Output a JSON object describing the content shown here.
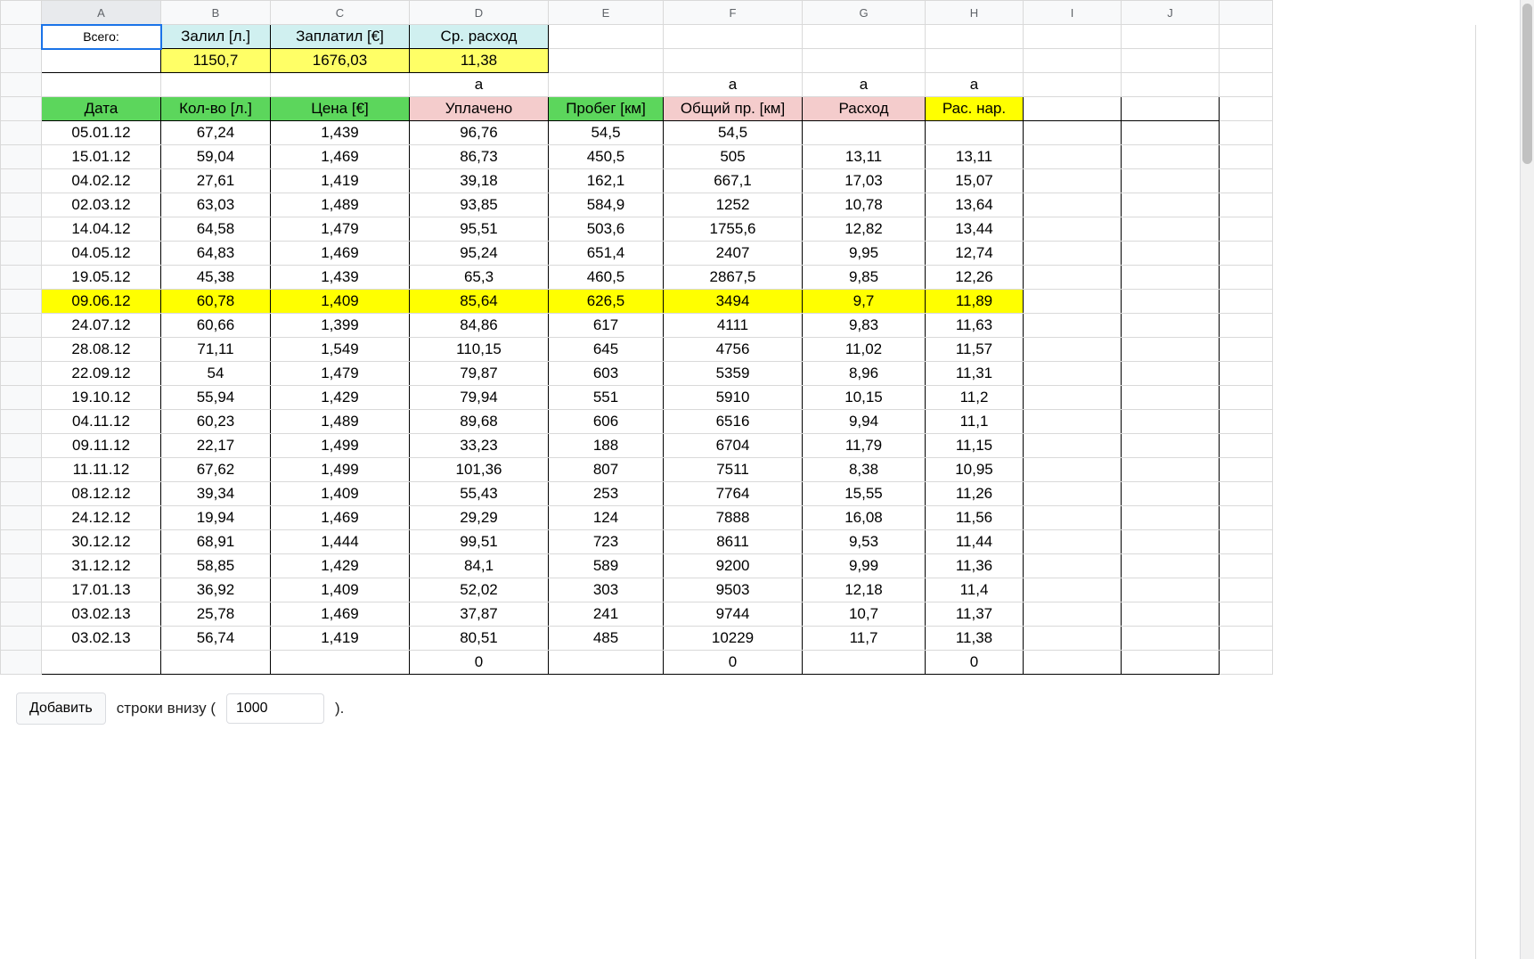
{
  "columns": [
    "A",
    "B",
    "C",
    "D",
    "E",
    "F",
    "G",
    "H",
    "I",
    "J"
  ],
  "summary": {
    "label": "Всего:",
    "filled_header": "Залил [л.]",
    "paid_header": "Заплатил [€]",
    "avg_header": "Ср. расход",
    "filled_value": "1150,7",
    "paid_value": "1676,03",
    "avg_value": "11,38"
  },
  "a_row": {
    "D": "a",
    "F": "a",
    "G": "a",
    "H": "a"
  },
  "headers": {
    "A": "Дата",
    "B": "Кол-во [л.]",
    "C": "Цена [€]",
    "D": "Уплачено",
    "E": "Пробег [км]",
    "F": "Общий пр. [км]",
    "G": "Расход",
    "H": "Рас. нар."
  },
  "highlight_row_index": 7,
  "rows": [
    {
      "A": "05.01.12",
      "B": "67,24",
      "C": "1,439",
      "D": "96,76",
      "E": "54,5",
      "F": "54,5",
      "G": "",
      "H": ""
    },
    {
      "A": "15.01.12",
      "B": "59,04",
      "C": "1,469",
      "D": "86,73",
      "E": "450,5",
      "F": "505",
      "G": "13,11",
      "H": "13,11"
    },
    {
      "A": "04.02.12",
      "B": "27,61",
      "C": "1,419",
      "D": "39,18",
      "E": "162,1",
      "F": "667,1",
      "G": "17,03",
      "H": "15,07"
    },
    {
      "A": "02.03.12",
      "B": "63,03",
      "C": "1,489",
      "D": "93,85",
      "E": "584,9",
      "F": "1252",
      "G": "10,78",
      "H": "13,64"
    },
    {
      "A": "14.04.12",
      "B": "64,58",
      "C": "1,479",
      "D": "95,51",
      "E": "503,6",
      "F": "1755,6",
      "G": "12,82",
      "H": "13,44"
    },
    {
      "A": "04.05.12",
      "B": "64,83",
      "C": "1,469",
      "D": "95,24",
      "E": "651,4",
      "F": "2407",
      "G": "9,95",
      "H": "12,74"
    },
    {
      "A": "19.05.12",
      "B": "45,38",
      "C": "1,439",
      "D": "65,3",
      "E": "460,5",
      "F": "2867,5",
      "G": "9,85",
      "H": "12,26"
    },
    {
      "A": "09.06.12",
      "B": "60,78",
      "C": "1,409",
      "D": "85,64",
      "E": "626,5",
      "F": "3494",
      "G": "9,7",
      "H": "11,89"
    },
    {
      "A": "24.07.12",
      "B": "60,66",
      "C": "1,399",
      "D": "84,86",
      "E": "617",
      "F": "4111",
      "G": "9,83",
      "H": "11,63"
    },
    {
      "A": "28.08.12",
      "B": "71,11",
      "C": "1,549",
      "D": "110,15",
      "E": "645",
      "F": "4756",
      "G": "11,02",
      "H": "11,57"
    },
    {
      "A": "22.09.12",
      "B": "54",
      "C": "1,479",
      "D": "79,87",
      "E": "603",
      "F": "5359",
      "G": "8,96",
      "H": "11,31"
    },
    {
      "A": "19.10.12",
      "B": "55,94",
      "C": "1,429",
      "D": "79,94",
      "E": "551",
      "F": "5910",
      "G": "10,15",
      "H": "11,2"
    },
    {
      "A": "04.11.12",
      "B": "60,23",
      "C": "1,489",
      "D": "89,68",
      "E": "606",
      "F": "6516",
      "G": "9,94",
      "H": "11,1"
    },
    {
      "A": "09.11.12",
      "B": "22,17",
      "C": "1,499",
      "D": "33,23",
      "E": "188",
      "F": "6704",
      "G": "11,79",
      "H": "11,15"
    },
    {
      "A": "11.11.12",
      "B": "67,62",
      "C": "1,499",
      "D": "101,36",
      "E": "807",
      "F": "7511",
      "G": "8,38",
      "H": "10,95"
    },
    {
      "A": "08.12.12",
      "B": "39,34",
      "C": "1,409",
      "D": "55,43",
      "E": "253",
      "F": "7764",
      "G": "15,55",
      "H": "11,26"
    },
    {
      "A": "24.12.12",
      "B": "19,94",
      "C": "1,469",
      "D": "29,29",
      "E": "124",
      "F": "7888",
      "G": "16,08",
      "H": "11,56"
    },
    {
      "A": "30.12.12",
      "B": "68,91",
      "C": "1,444",
      "D": "99,51",
      "E": "723",
      "F": "8611",
      "G": "9,53",
      "H": "11,44"
    },
    {
      "A": "31.12.12",
      "B": "58,85",
      "C": "1,429",
      "D": "84,1",
      "E": "589",
      "F": "9200",
      "G": "9,99",
      "H": "11,36"
    },
    {
      "A": "17.01.13",
      "B": "36,92",
      "C": "1,409",
      "D": "52,02",
      "E": "303",
      "F": "9503",
      "G": "12,18",
      "H": "11,4"
    },
    {
      "A": "03.02.13",
      "B": "25,78",
      "C": "1,469",
      "D": "37,87",
      "E": "241",
      "F": "9744",
      "G": "10,7",
      "H": "11,37"
    },
    {
      "A": "03.02.13",
      "B": "56,74",
      "C": "1,419",
      "D": "80,51",
      "E": "485",
      "F": "10229",
      "G": "11,7",
      "H": "11,38"
    }
  ],
  "zero_row": {
    "D": "0",
    "F": "0",
    "H": "0"
  },
  "footer": {
    "add_button": "Добавить",
    "rows_text_before": "строки внизу (",
    "rows_input_value": "1000",
    "rows_text_after": ")."
  }
}
